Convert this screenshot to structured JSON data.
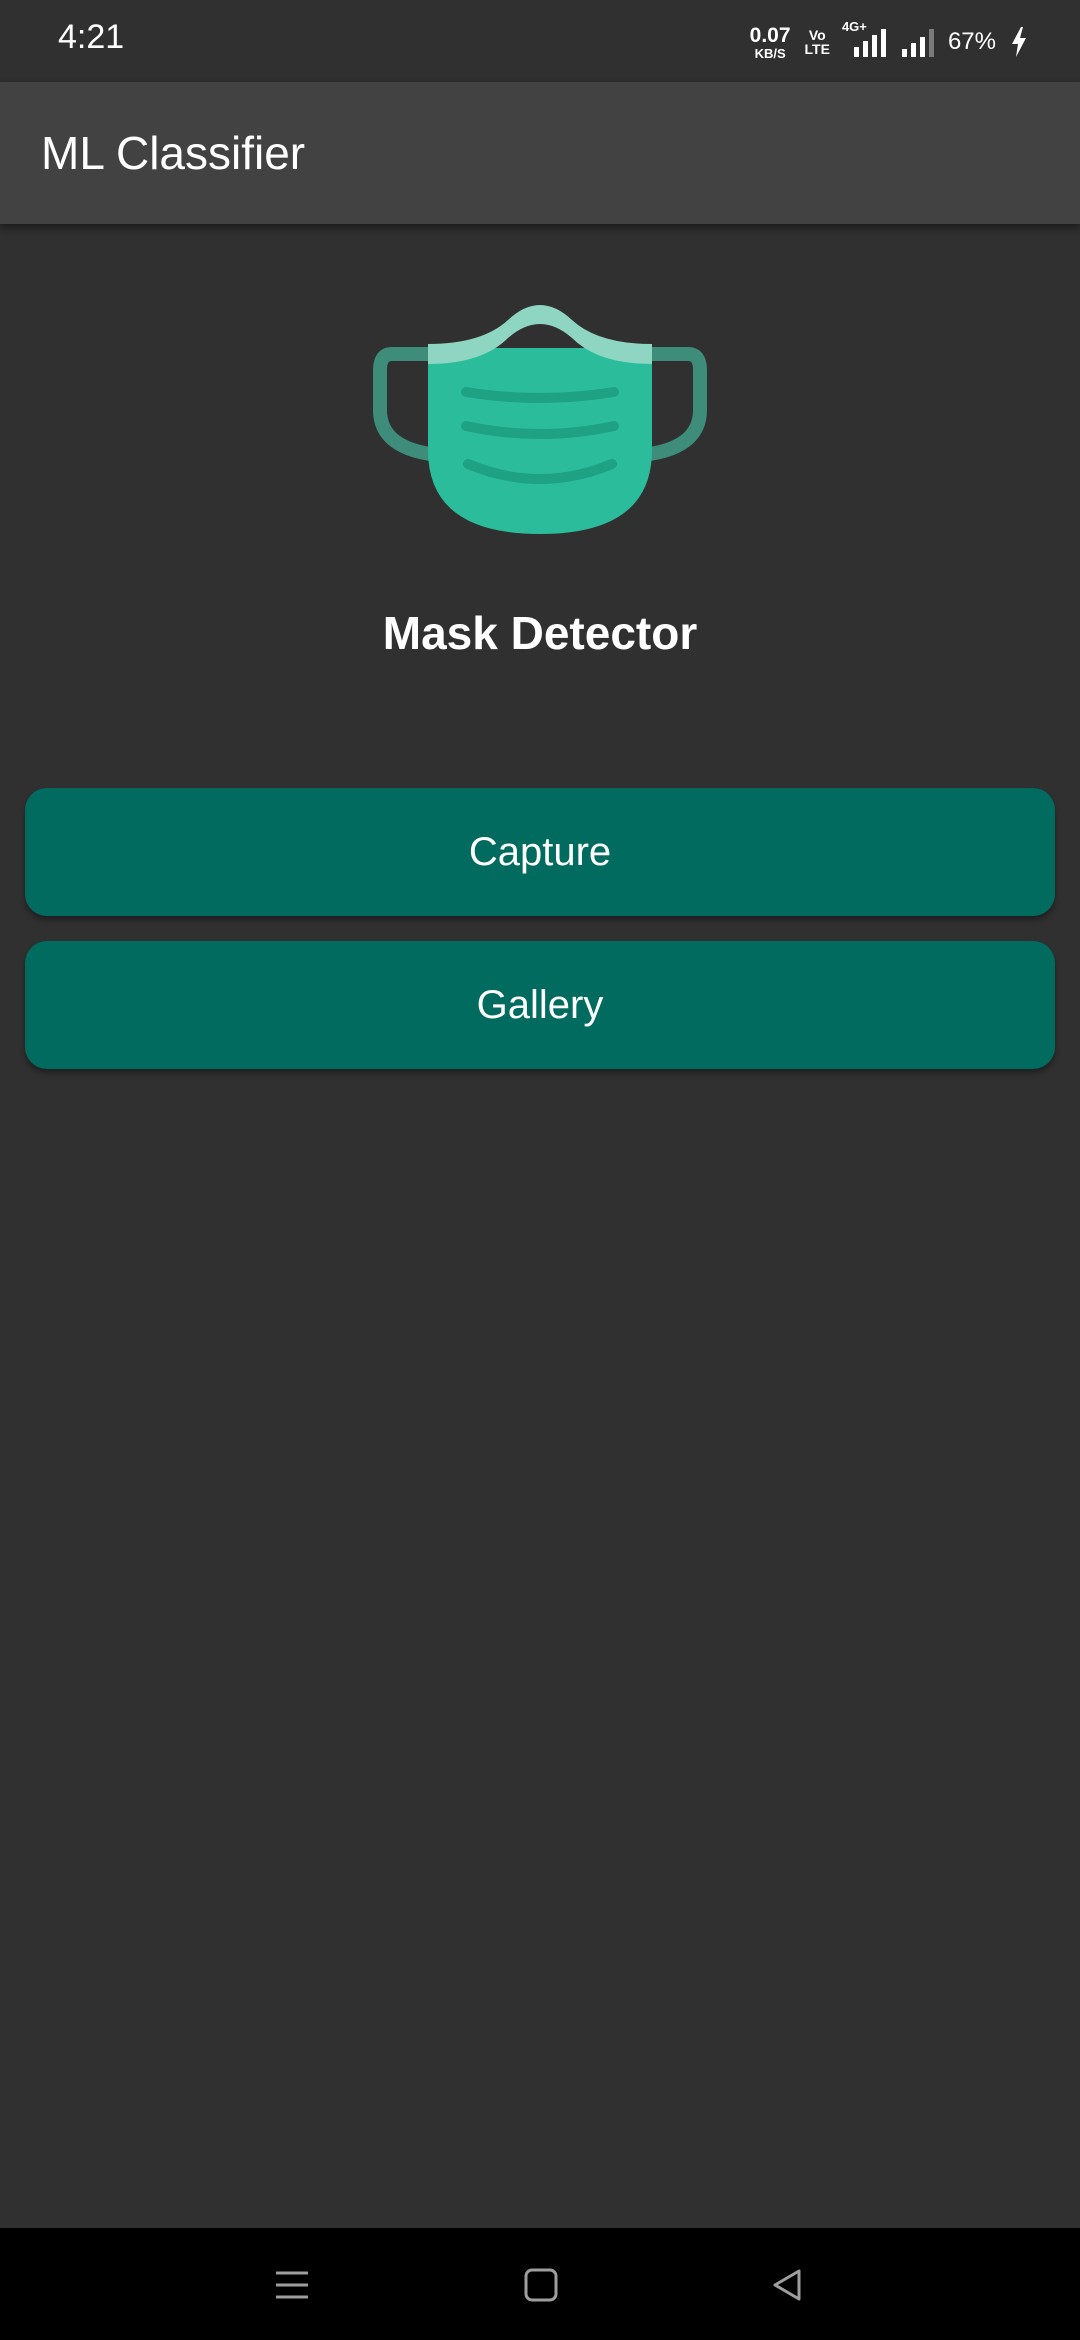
{
  "status_bar": {
    "time": "4:21",
    "net_speed_value": "0.07",
    "net_speed_unit": "KB/S",
    "volte_top": "Vo",
    "volte_bottom": "LTE",
    "network_type": "4G+",
    "battery_percent": "67%",
    "icons": [
      "volte-icon",
      "signal-4g-icon",
      "signal-icon",
      "charging-bolt-icon"
    ]
  },
  "app_bar": {
    "title": "ML Classifier"
  },
  "main": {
    "logo_icon": "face-mask-icon",
    "headline": "Mask Detector",
    "buttons": {
      "capture_label": "Capture",
      "gallery_label": "Gallery"
    }
  },
  "nav_bar": {
    "icons": [
      "menu-icon",
      "home-icon",
      "back-icon"
    ]
  },
  "colors": {
    "background": "#303030",
    "app_bar": "#424242",
    "button": "#006b5e",
    "mask": "#2bbd9b"
  }
}
